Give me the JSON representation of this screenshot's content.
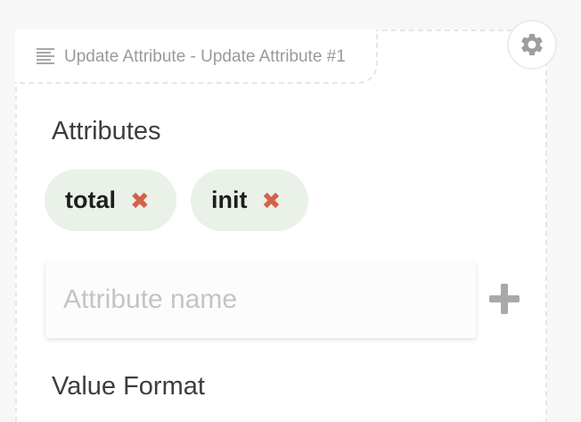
{
  "panel": {
    "title": "Update Attribute - Update Attribute #1",
    "title_icon": "lines-icon",
    "settings_icon": "gear-icon"
  },
  "attributes": {
    "heading": "Attributes",
    "chips": [
      {
        "label": "total",
        "remove_icon": "close-icon"
      },
      {
        "label": "init",
        "remove_icon": "close-icon"
      }
    ],
    "input": {
      "value": "",
      "placeholder": "Attribute name"
    },
    "add_icon": "plus-icon"
  },
  "value_format": {
    "heading": "Value Format"
  },
  "colors": {
    "chip_bg": "#eaf1e8",
    "remove_icon": "#d5614a",
    "muted_text": "#9a9a9a"
  }
}
